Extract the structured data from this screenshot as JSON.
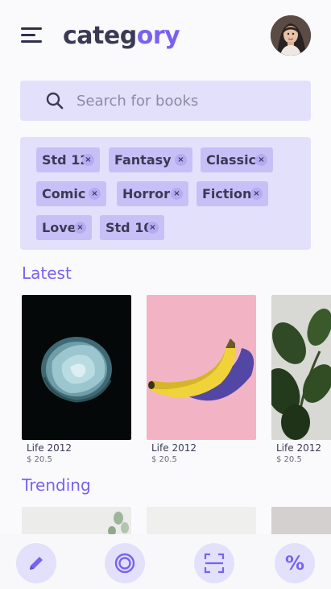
{
  "header": {
    "brand_main": "categ",
    "brand_accent": "ory"
  },
  "search": {
    "placeholder": "Search for books",
    "value": ""
  },
  "tags": [
    "Std 12",
    "Fantasy",
    "Classic",
    "Comic",
    "Horror",
    "Fiction",
    "Love",
    "Std 10"
  ],
  "tag_remove_symbol": "×",
  "sections": {
    "latest": {
      "title": "Latest",
      "items": [
        {
          "name": "Life 2012",
          "price": "$ 20.5"
        },
        {
          "name": "Life 2012",
          "price": "$ 20.5"
        },
        {
          "name": "Life 2012",
          "price": "$ 20.5"
        }
      ]
    },
    "trending": {
      "title": "Trending"
    }
  },
  "nav": {
    "items": [
      "edit-icon",
      "target-icon",
      "scan-icon",
      "percent-icon"
    ],
    "percent_label": "%"
  },
  "colors": {
    "accent": "#7a62f0",
    "panel": "#e3e0fb",
    "chip": "#c6c0f7",
    "text": "#3a3a55"
  }
}
